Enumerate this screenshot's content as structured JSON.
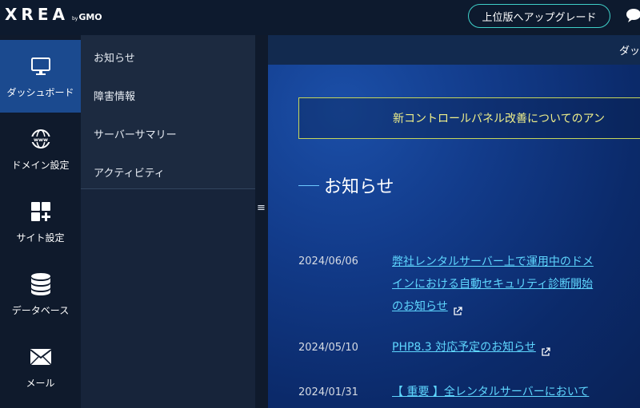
{
  "header": {
    "logo_main": "XREA",
    "logo_by": "by",
    "logo_gmo": "GMO",
    "upgrade_label": "上位版へアップグレード",
    "chat_icon": "chat-bubble-icon"
  },
  "sidebar": {
    "items": [
      {
        "label": "ダッシュボード",
        "icon": "monitor-icon",
        "active": true
      },
      {
        "label": "ドメイン設定",
        "icon": "globe-www-icon",
        "active": false
      },
      {
        "label": "サイト設定",
        "icon": "grid-plus-icon",
        "active": false
      },
      {
        "label": "データベース",
        "icon": "database-icon",
        "active": false
      },
      {
        "label": "メール",
        "icon": "envelope-icon",
        "active": false
      }
    ]
  },
  "subnav": {
    "items": [
      "お知らせ",
      "障害情報",
      "サーバーサマリー",
      "アクティビティ"
    ]
  },
  "main": {
    "breadcrumb": "ダッ",
    "notice_banner": "新コントロールパネル改善についてのアン",
    "section_title": "お知らせ",
    "news": [
      {
        "date": "2024/06/06",
        "lines": [
          "弊社レンタルサーバー上で運用中のドメ",
          "インにおける自動セキュリティ診断開始",
          "のお知らせ"
        ]
      },
      {
        "date": "2024/05/10",
        "lines": [
          "PHP8.3 対応予定のお知らせ"
        ]
      },
      {
        "date": "2024/01/31",
        "lines": [
          "【 重要 】全レンタルサーバーにおいて"
        ]
      }
    ]
  },
  "colors": {
    "accent_teal": "#3fd0c9",
    "active_nav": "#1b4a8f",
    "link": "#5fd7ff",
    "notice_border": "#c7d65a"
  }
}
